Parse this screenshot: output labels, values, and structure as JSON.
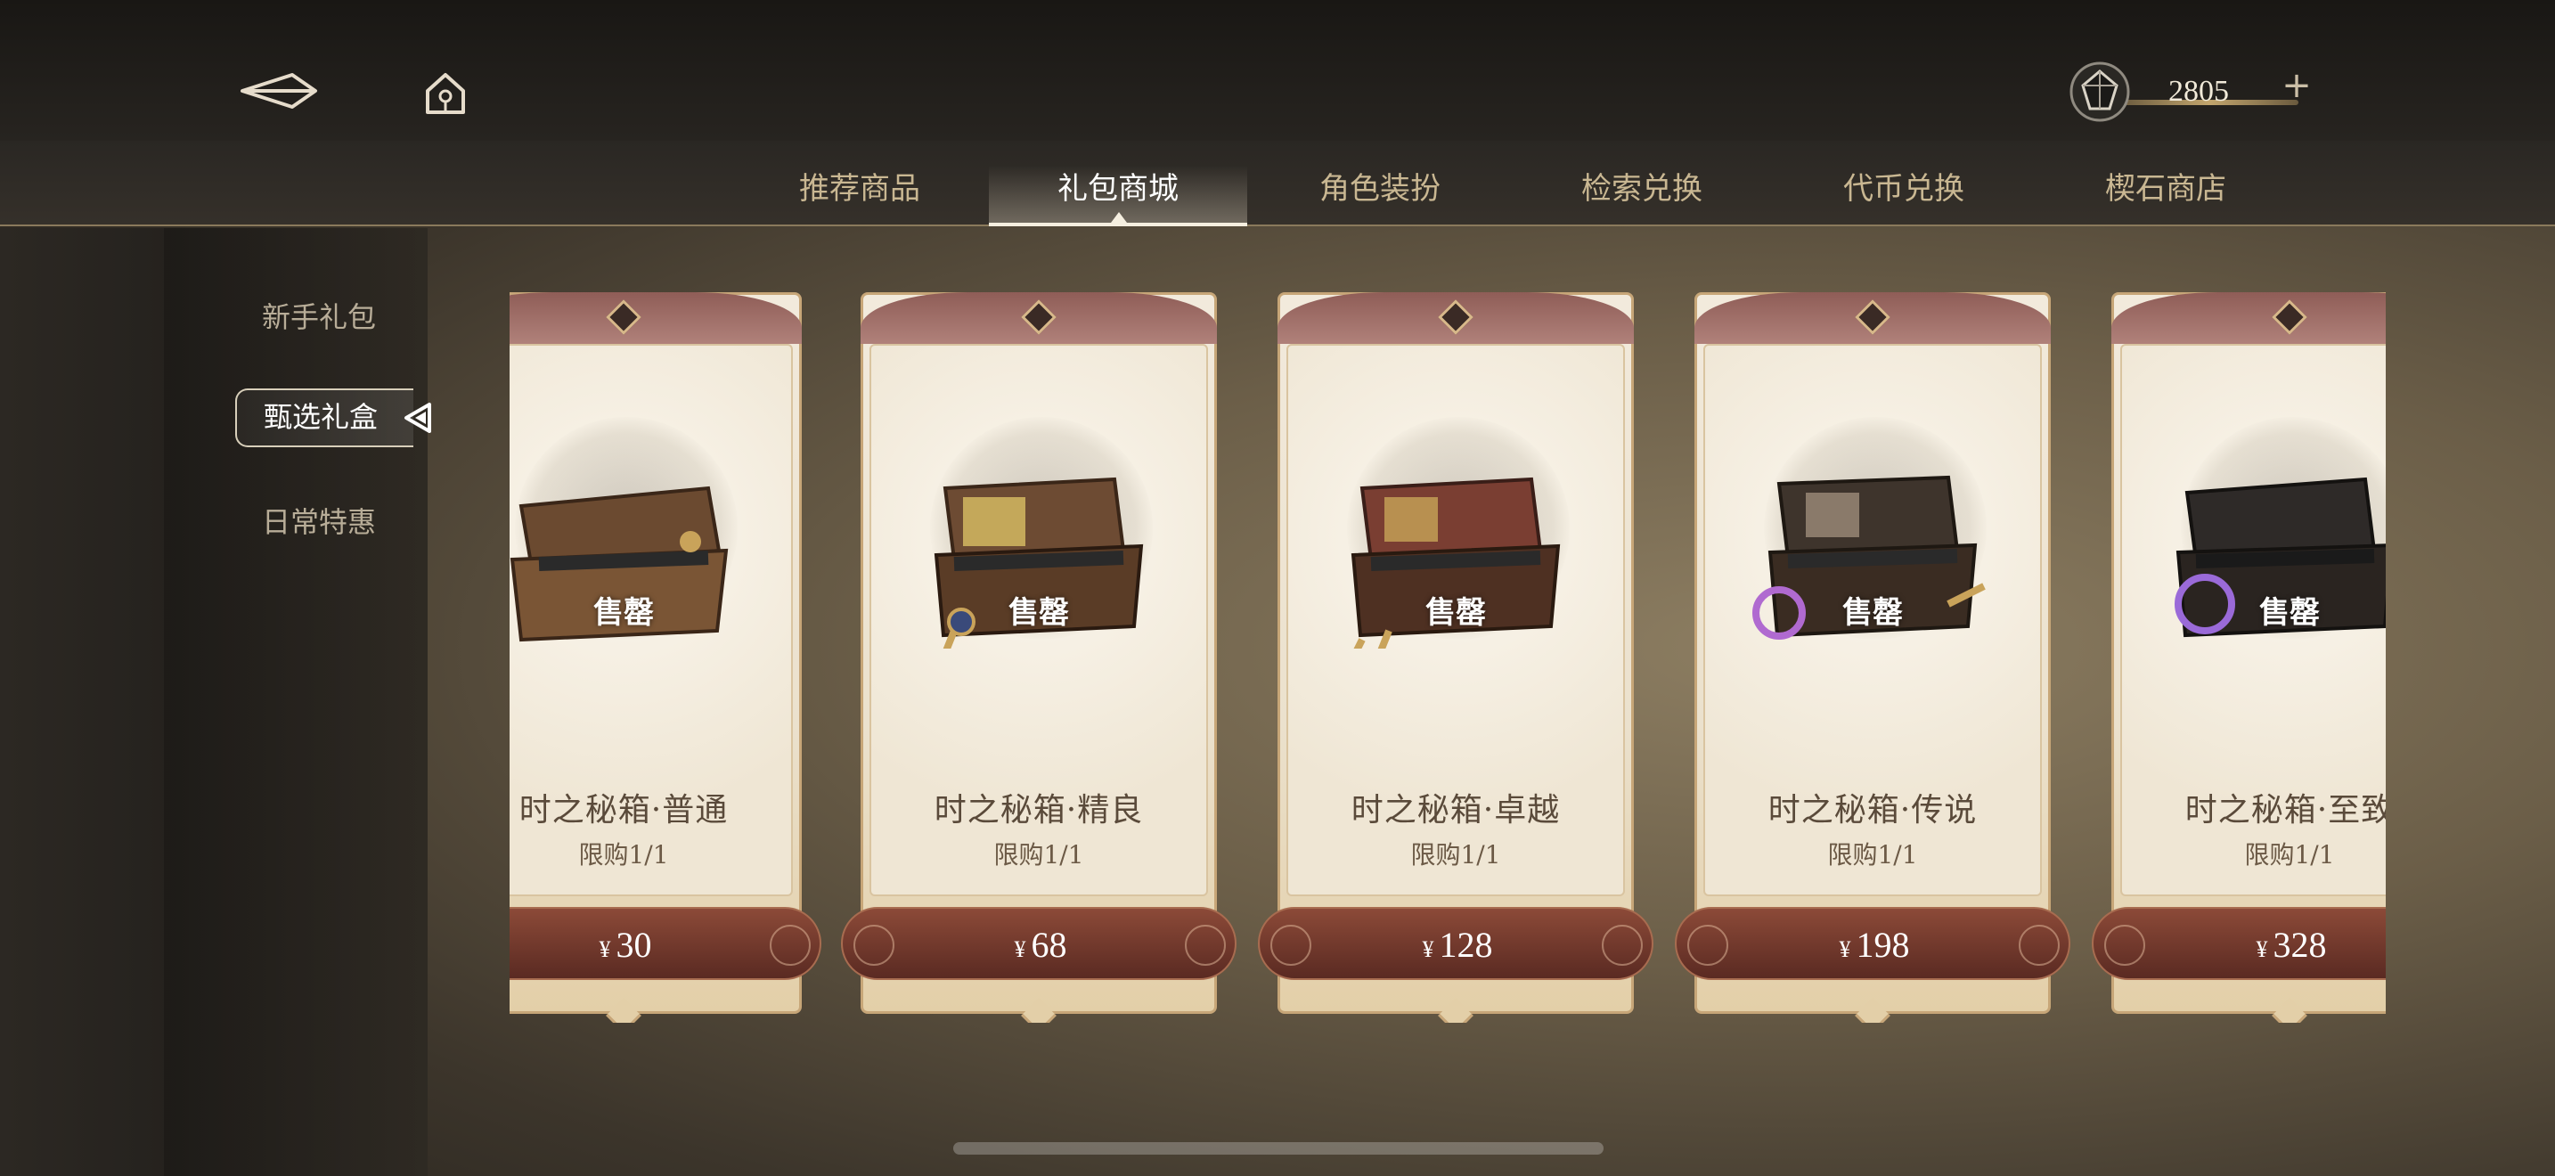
{
  "header": {
    "back_icon": "back-arrow-icon",
    "home_icon": "home-icon",
    "currency": {
      "icon": "gem-icon",
      "amount": "2805",
      "add_label": "+"
    }
  },
  "tabs": [
    {
      "label": "推荐商品",
      "active": false
    },
    {
      "label": "礼包商城",
      "active": true
    },
    {
      "label": "角色装扮",
      "active": false
    },
    {
      "label": "检索兑换",
      "active": false
    },
    {
      "label": "代币兑换",
      "active": false
    },
    {
      "label": "楔石商店",
      "active": false
    }
  ],
  "sidebar": {
    "items": [
      {
        "label": "新手礼包",
        "active": false
      },
      {
        "label": "甄选礼盒",
        "active": true
      },
      {
        "label": "日常特惠",
        "active": false
      }
    ]
  },
  "cards": [
    {
      "name": "时之秘箱·普通",
      "limit": "限购1/1",
      "status": "售罄",
      "currency_symbol": "¥",
      "price": "30"
    },
    {
      "name": "时之秘箱·精良",
      "limit": "限购1/1",
      "status": "售罄",
      "currency_symbol": "¥",
      "price": "68"
    },
    {
      "name": "时之秘箱·卓越",
      "limit": "限购1/1",
      "status": "售罄",
      "currency_symbol": "¥",
      "price": "128"
    },
    {
      "name": "时之秘箱·传说",
      "limit": "限购1/1",
      "status": "售罄",
      "currency_symbol": "¥",
      "price": "198"
    },
    {
      "name": "时之秘箱·至致",
      "limit": "限购1/1",
      "status": "售罄",
      "currency_symbol": "¥",
      "price": "328"
    }
  ],
  "colors": {
    "accent_gold": "#c7a678",
    "price_bar": "#7a3a2c",
    "card_bg": "#f2eadc",
    "tab_inactive": "#c9b792"
  }
}
